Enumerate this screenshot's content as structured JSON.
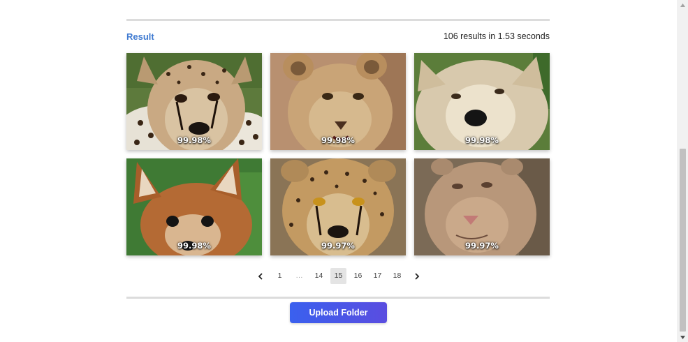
{
  "result": {
    "title": "Result",
    "summary": "106 results in 1.53 seconds"
  },
  "results": [
    {
      "animal": "cheetah",
      "score": "99.98%"
    },
    {
      "animal": "lion cub",
      "score": "99.98%"
    },
    {
      "animal": "white wolf",
      "score": "99.98%"
    },
    {
      "animal": "fox cub",
      "score": "99.98%"
    },
    {
      "animal": "cheetah",
      "score": "99.97%"
    },
    {
      "animal": "lioness",
      "score": "99.97%"
    }
  ],
  "pagination": {
    "prev_icon": "chevron-left-icon",
    "next_icon": "chevron-right-icon",
    "pages": [
      "1",
      "…",
      "14",
      "15",
      "16",
      "17",
      "18"
    ],
    "current": "15"
  },
  "upload": {
    "label": "Upload Folder",
    "gradient": [
      "#3a60ee",
      "#5a4de0"
    ]
  },
  "colors": {
    "accent": "#3f7ad1"
  }
}
